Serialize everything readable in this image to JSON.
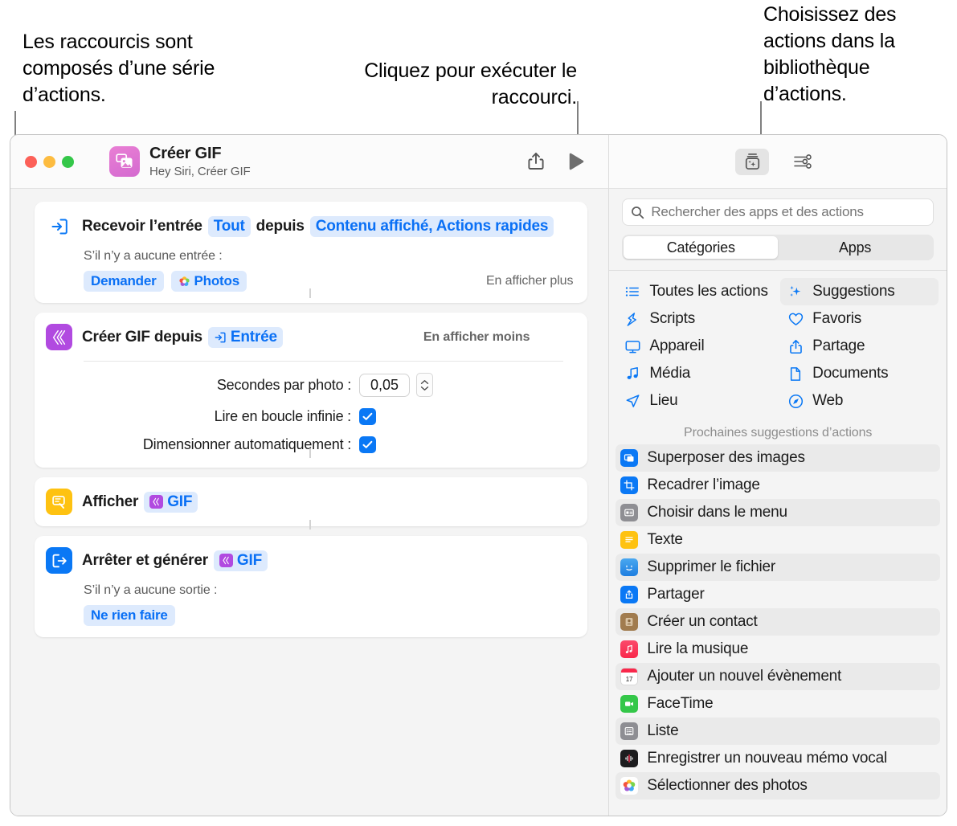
{
  "callouts": {
    "left": "Les raccourcis sont composés d’une série d’actions.",
    "middle": "Cliquez pour exécuter le raccourci.",
    "right": "Choisissez des actions dans la bibliothèque d’actions."
  },
  "window": {
    "titlebar": {
      "shortcut_name": "Créer GIF",
      "shortcut_subtitle": "Hey Siri, Créer GIF",
      "app_icon": "photos-stack-icon",
      "share_button": "share-icon",
      "run_button": "play-icon",
      "library_button": "action-library-icon",
      "details_button": "sliders-icon"
    },
    "actions": [
      {
        "icon": "receive-input-icon",
        "icon_color": "#ffffff",
        "title_parts": [
          {
            "text": "Recevoir l’entrée",
            "type": "plain"
          },
          {
            "text": "Tout",
            "type": "token"
          },
          {
            "text": "depuis",
            "type": "plain"
          },
          {
            "text": "Contenu affiché, Actions rapides",
            "type": "token"
          }
        ],
        "show_toggle": "En afficher plus",
        "sub_label": "S’il n’y a aucune entrée :",
        "sub_tokens": [
          {
            "text": "Demander",
            "icon": null
          },
          {
            "text": "Photos",
            "icon": "photos-app-icon"
          }
        ]
      },
      {
        "icon": "create-gif-icon",
        "icon_color": "#b14ae0",
        "title_parts": [
          {
            "text": "Créer GIF depuis",
            "type": "plain"
          },
          {
            "text": "Entrée",
            "type": "token",
            "icon": "input-icon"
          }
        ],
        "show_toggle": "En afficher moins",
        "params": [
          {
            "label": "Secondes par photo :",
            "kind": "stepper",
            "value": "0,05"
          },
          {
            "label": "Lire en boucle infinie :",
            "kind": "checkbox",
            "checked": true
          },
          {
            "label": "Dimensionner automatiquement :",
            "kind": "checkbox",
            "checked": true
          }
        ]
      },
      {
        "icon": "quick-look-icon",
        "icon_color": "#fec211",
        "title_parts": [
          {
            "text": "Afficher",
            "type": "plain"
          },
          {
            "text": "GIF",
            "type": "token",
            "icon": "gif-variable-icon"
          }
        ]
      },
      {
        "icon": "stop-output-icon",
        "icon_color": "#0a78f5",
        "title_parts": [
          {
            "text": "Arrêter et générer",
            "type": "plain"
          },
          {
            "text": "GIF",
            "type": "token",
            "icon": "gif-variable-icon"
          }
        ],
        "sub_label": "S’il n’y a aucune sortie :",
        "sub_tokens": [
          {
            "text": "Ne rien faire",
            "icon": null
          }
        ]
      }
    ],
    "library": {
      "search_placeholder": "Rechercher des apps et des actions",
      "search_value": "",
      "segments": [
        {
          "label": "Catégories",
          "active": true
        },
        {
          "label": "Apps",
          "active": false
        }
      ],
      "categories": [
        {
          "label": "Toutes les actions",
          "icon": "list-bullet-icon",
          "active": false
        },
        {
          "label": "Suggestions",
          "icon": "sparkles-icon",
          "active": true
        },
        {
          "label": "Scripts",
          "icon": "scripts-icon",
          "active": false
        },
        {
          "label": "Favoris",
          "icon": "heart-icon",
          "active": false
        },
        {
          "label": "Appareil",
          "icon": "display-icon",
          "active": false
        },
        {
          "label": "Partage",
          "icon": "share-icon",
          "active": false
        },
        {
          "label": "Média",
          "icon": "music-note-icon",
          "active": false
        },
        {
          "label": "Documents",
          "icon": "document-icon",
          "active": false
        },
        {
          "label": "Lieu",
          "icon": "location-arrow-icon",
          "active": false
        },
        {
          "label": "Web",
          "icon": "safari-compass-icon",
          "active": false
        }
      ],
      "suggestions_header": "Prochaines suggestions d’actions",
      "suggestions": [
        {
          "label": "Superposer des images",
          "icon": "overlay-images-icon",
          "color": "#0a78f5"
        },
        {
          "label": "Recadrer l’image",
          "icon": "crop-icon",
          "color": "#0a78f5"
        },
        {
          "label": "Choisir dans le menu",
          "icon": "menu-picker-icon",
          "color": "#8e8e93"
        },
        {
          "label": "Texte",
          "icon": "text-icon",
          "color": "#fec211"
        },
        {
          "label": "Supprimer le fichier",
          "icon": "finder-icon",
          "color": "#4aa8f0"
        },
        {
          "label": "Partager",
          "icon": "share-sheet-icon",
          "color": "#0a78f5"
        },
        {
          "label": "Créer un contact",
          "icon": "contacts-icon",
          "color": "#a17c4f"
        },
        {
          "label": "Lire la musique",
          "icon": "music-icon",
          "color": "#f9355a"
        },
        {
          "label": "Ajouter un nouvel évènement",
          "icon": "calendar-icon",
          "color": "#ffffff"
        },
        {
          "label": "FaceTime",
          "icon": "facetime-icon",
          "color": "#34c749"
        },
        {
          "label": "Liste",
          "icon": "list-icon",
          "color": "#8e8e93"
        },
        {
          "label": "Enregistrer un nouveau mémo vocal",
          "icon": "voice-memo-icon",
          "color": "#1c1c1e"
        },
        {
          "label": "Sélectionner des photos",
          "icon": "photos-app-icon",
          "color": "#ffffff"
        }
      ]
    }
  },
  "colors": {
    "accent_blue": "#0a78f5",
    "token_bg": "#ddeafd",
    "window_bg": "#f4f4f4",
    "card_bg": "#ffffff",
    "leader_line": "#808080"
  }
}
